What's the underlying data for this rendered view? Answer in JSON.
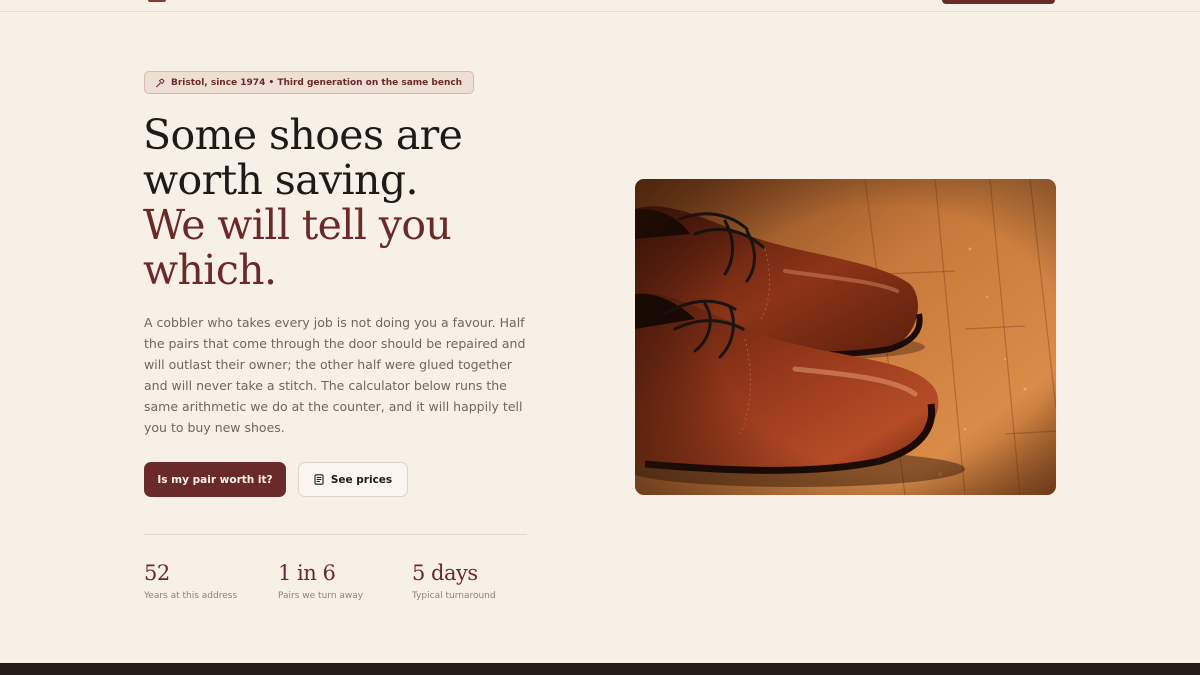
{
  "hero": {
    "badge": "Bristol, since 1974 • Third generation on the same bench",
    "headline_line1": "Some shoes are",
    "headline_line2": "worth saving.",
    "headline_line3": "We will tell you",
    "headline_line4": "which.",
    "lede": "A cobbler who takes every job is not doing you a favour. Half the pairs that come through the door should be repaired and will outlast their owner; the other half were glued together and will never take a stitch. The calculator below runs the same arithmetic we do at the counter, and it will happily tell you to buy new shoes.",
    "primary_cta": "Is my pair worth it?",
    "secondary_cta": "See prices"
  },
  "stats": [
    {
      "value": "52",
      "label": "Years at this address"
    },
    {
      "value": "1 in 6",
      "label": "Pairs we turn away"
    },
    {
      "value": "5 days",
      "label": "Typical turnaround"
    }
  ],
  "icons": {
    "badge_icon": "hammer-icon",
    "secondary_cta_icon": "price-list-icon"
  },
  "colors": {
    "background": "#f7f0e6",
    "accent": "#6b2a2a",
    "text": "#1e1a17",
    "muted": "#6f665e",
    "footer": "#231c1a"
  }
}
